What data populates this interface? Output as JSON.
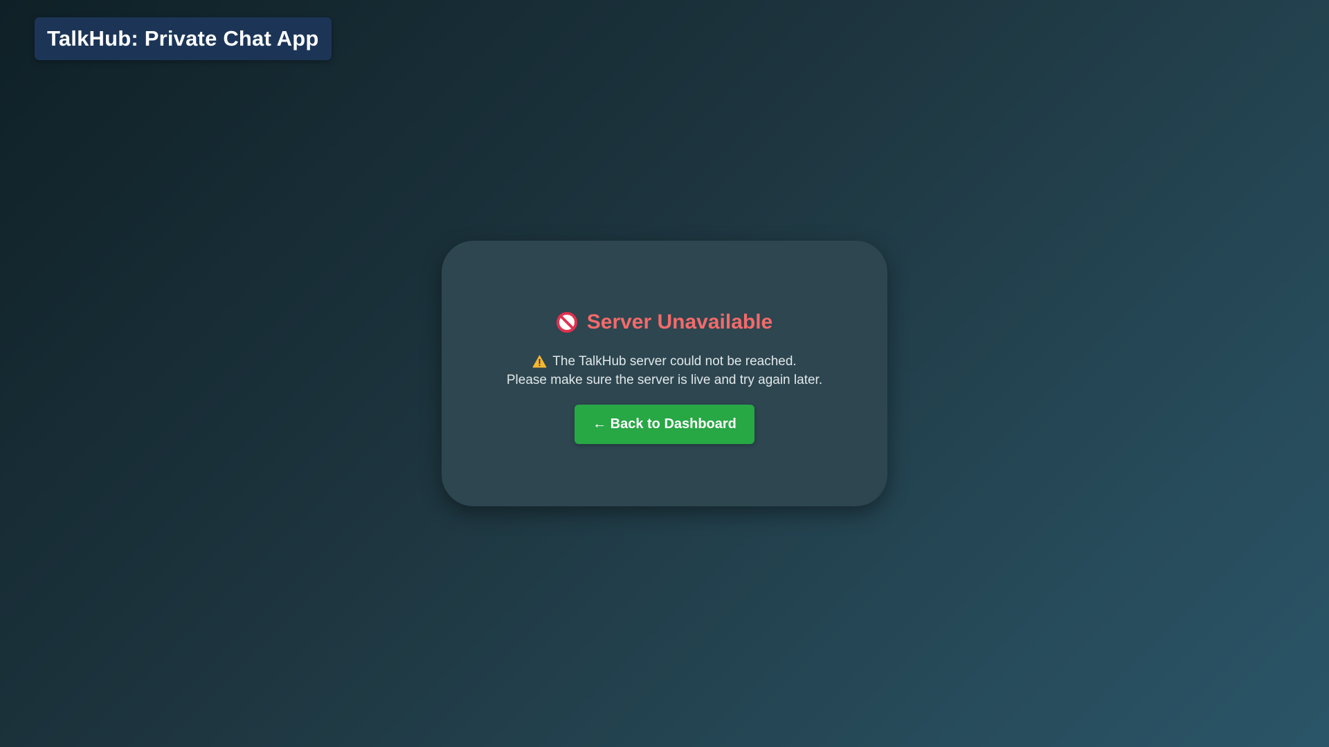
{
  "app": {
    "title": "TalkHub: Private Chat App"
  },
  "error_card": {
    "icon": "no-entry-icon",
    "title": "Server Unavailable",
    "warning_icon": "warning-icon",
    "message_line1": "The TalkHub server could not be reached.",
    "message_line2": "Please make sure the server is live and try again later.",
    "back_button_label": "← Back to Dashboard"
  },
  "colors": {
    "heading": "#f46a6a",
    "button": "#28a745",
    "card": "#2d4650",
    "badge": "#1c3557"
  }
}
